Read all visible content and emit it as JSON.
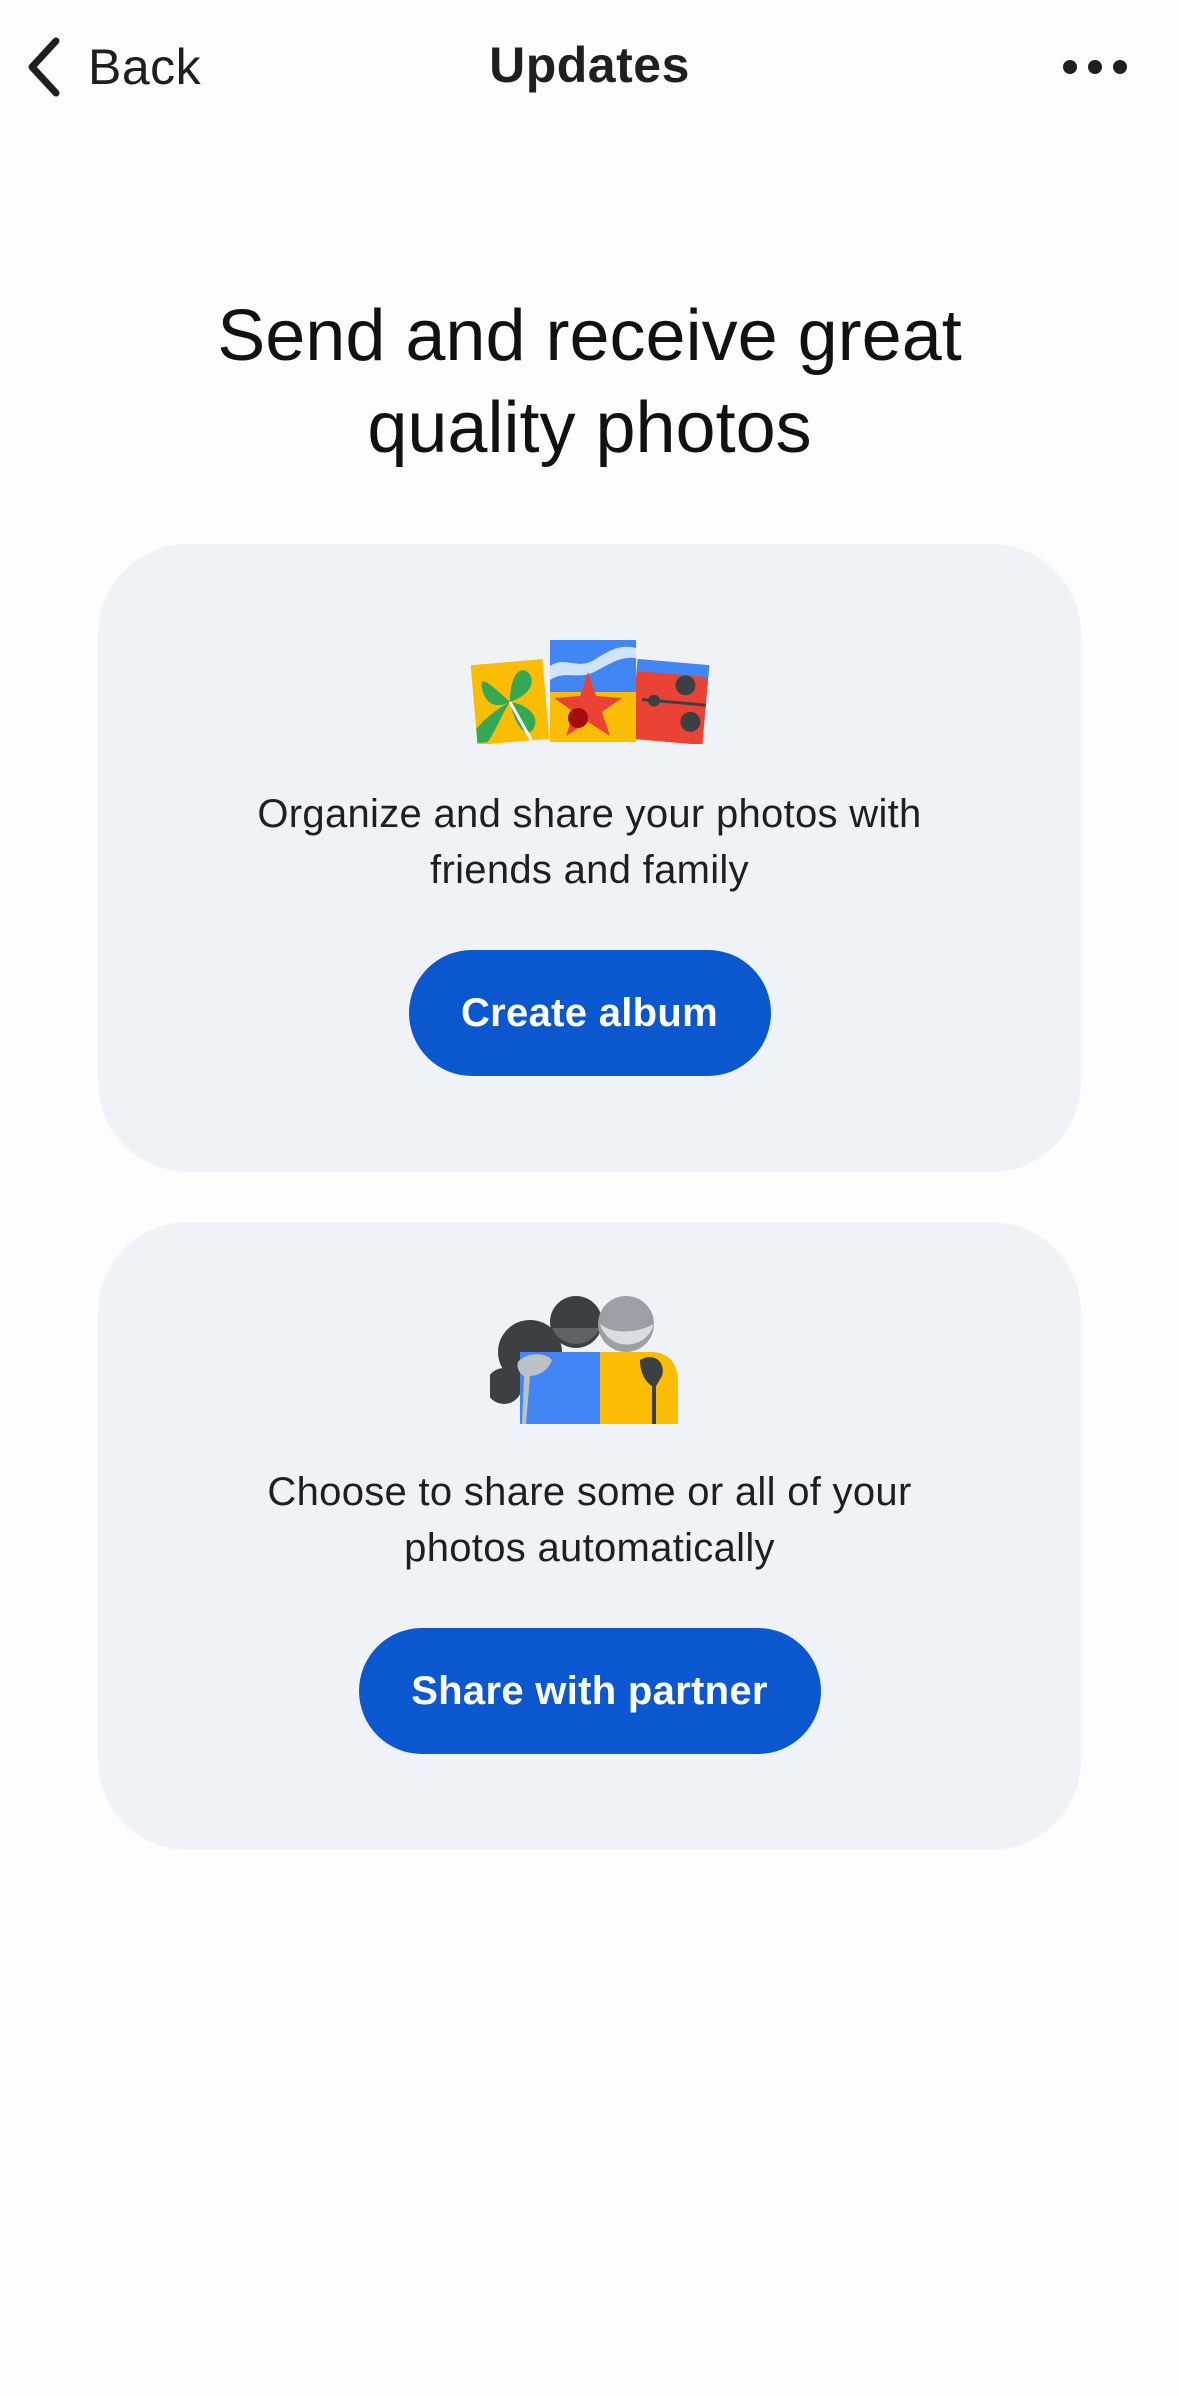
{
  "nav": {
    "back_label": "Back",
    "title": "Updates",
    "more_icon": "more-horizontal-icon"
  },
  "headline": {
    "line1": "Send and receive great",
    "line2": "quality photos"
  },
  "cards": [
    {
      "illustration": "photo-album-illustration",
      "text_line1": "Organize and share your photos with",
      "text_line2": "friends and family",
      "button_label": "Create album"
    },
    {
      "illustration": "partner-sharing-illustration",
      "text_line1": "Choose to share some or all of your",
      "text_line2": "photos automatically",
      "button_label": "Share with partner"
    }
  ],
  "colors": {
    "accent": "#0b57d0",
    "card_background": "#eff2f7",
    "text": "#1f1f1f"
  }
}
